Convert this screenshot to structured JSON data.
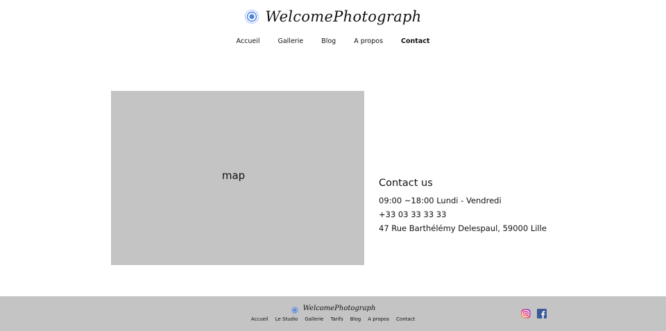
{
  "brand": {
    "name": "WelcomePhotograph",
    "icon": "aperture-logo-icon"
  },
  "nav": {
    "items": [
      {
        "label": "Accueil"
      },
      {
        "label": "Gallerie"
      },
      {
        "label": "Blog"
      },
      {
        "label": "A propos"
      },
      {
        "label": "Contact",
        "active": true
      }
    ]
  },
  "main": {
    "map_label": "map",
    "contact": {
      "title": "Contact us",
      "hours": "09:00 ~18:00 Lundi - Vendredi",
      "phone": "+33 03 33 33 33",
      "address": "47 Rue Barthélémy Delespaul, 59000 Lille"
    }
  },
  "footer": {
    "brand_name": "WelcomePhotograph",
    "nav": [
      "Accueil",
      "Le Studio",
      "Gallerie",
      "Tarifs",
      "Blog",
      "A propos",
      "Contact"
    ],
    "socials": [
      {
        "icon": "instagram-icon"
      },
      {
        "icon": "facebook-icon"
      }
    ]
  },
  "colors": {
    "background": "#ffffff",
    "panel_gray": "#c4c4c4",
    "logo_blue": "#4a7fe0",
    "facebook_blue": "#3b5998"
  }
}
